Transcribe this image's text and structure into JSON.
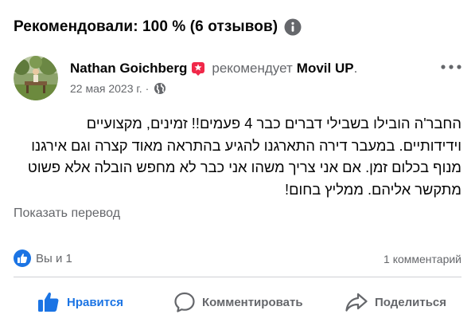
{
  "summary": {
    "text": "Рекомендовали: 100 % (6 отзывов)"
  },
  "post": {
    "author": "Nathan Goichberg",
    "recommends": "рекомендует",
    "page": "Movil UP",
    "page_suffix": ".",
    "date": "22 мая 2023 г.",
    "separator": "·",
    "text_lines": [
      "החבר'ה הובילו בשבילי דברים כבר 4 פעמים!! זמינים, מקצועיים",
      "וידידותיים. במעבר דירה התארגנו להגיע בהתראה מאוד קצרה וגם אירגנו",
      "מנוף בכלום זמן. אם אני צריך משהו אני כבר לא מחפש הובלה אלא פשוט",
      "מתקשר אליהם. ממליץ בחום!"
    ],
    "translate_link": "Показать перевод"
  },
  "stats": {
    "reactions": "Вы и 1",
    "comments": "1 комментарий"
  },
  "actions": {
    "like": "Нравится",
    "comment": "Комментировать",
    "share": "Поделиться"
  },
  "colors": {
    "accent": "#1b74e4",
    "secondary_text": "#65676b",
    "primary_text": "#050505",
    "badge_red": "#f02849"
  }
}
